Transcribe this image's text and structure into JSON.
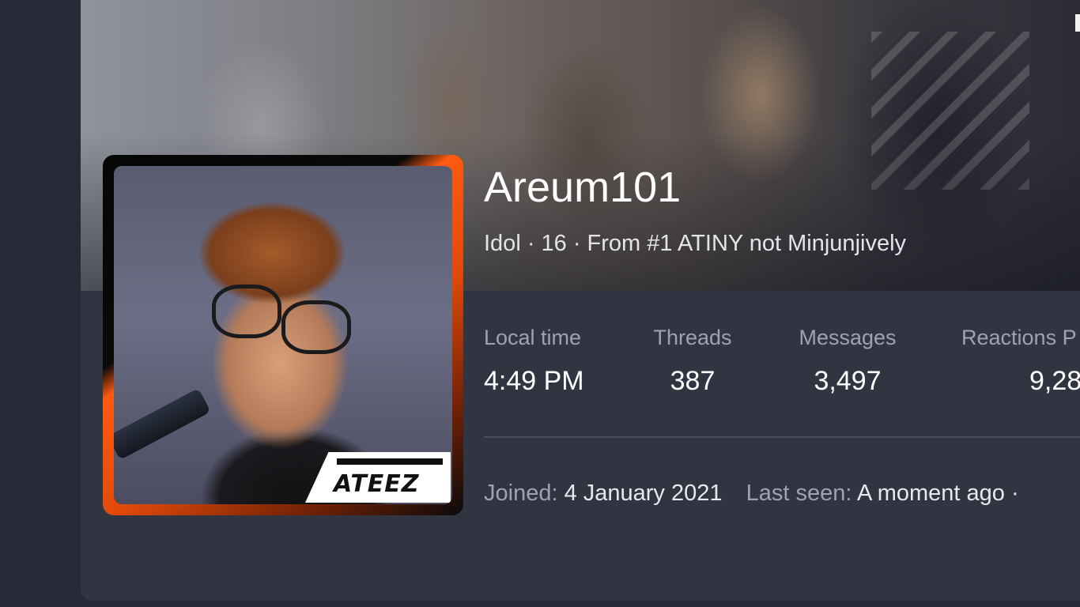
{
  "profile": {
    "username": "Areum101",
    "subtitle": "Idol · 16 · From #1 ATINY not Minjunjively",
    "avatar_logo": "ATEEZ"
  },
  "stats": [
    {
      "label": "Local time",
      "value": "4:49 PM"
    },
    {
      "label": "Threads",
      "value": "387"
    },
    {
      "label": "Messages",
      "value": "3,497"
    },
    {
      "label": "Reactions",
      "value": "9,28"
    }
  ],
  "stats_overflow_label": "P",
  "meta": {
    "joined_label": "Joined:",
    "joined_value": "4 January 2021",
    "last_seen_label": "Last seen:",
    "last_seen_value": "A moment ago ·"
  },
  "colors": {
    "page_bg": "#262a36",
    "card_bg": "#313542",
    "accent_orange": "#ff5a10",
    "label_gray": "#9ea3b4"
  }
}
